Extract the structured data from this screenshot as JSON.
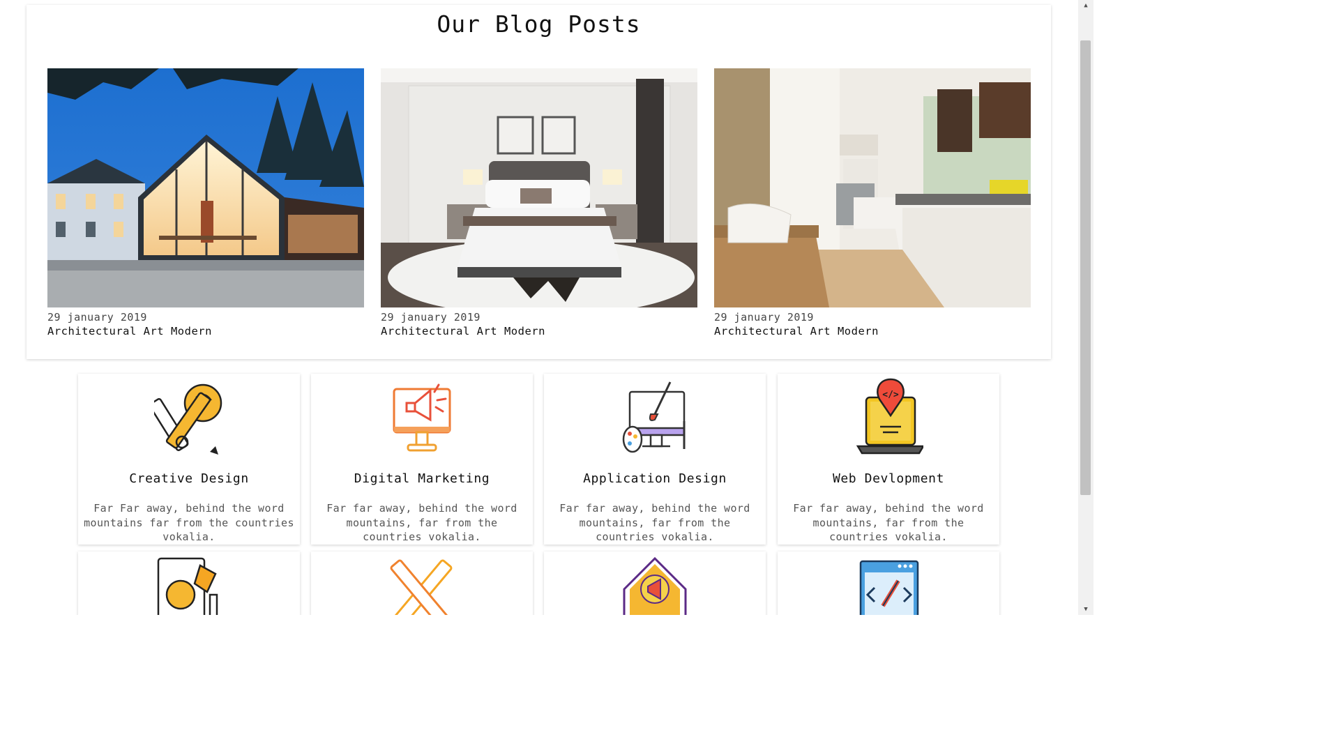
{
  "blog": {
    "title": "Our Blog Posts",
    "posts": [
      {
        "date": "29 january 2019",
        "title": "Architectural Art Modern",
        "image": "glass-house-exterior-night"
      },
      {
        "date": "29 january 2019",
        "title": "Architectural Art Modern",
        "image": "modern-bedroom-interior"
      },
      {
        "date": "29 january 2019",
        "title": "Architectural Art Modern",
        "image": "bright-kitchen-interior"
      }
    ]
  },
  "services": [
    {
      "title": "Creative Design",
      "desc": "Far Far away, behind the word mountains far from the countries vokalia.",
      "icon": "pencil-ruler-bulb-icon"
    },
    {
      "title": "Digital Marketing",
      "desc": "Far far away, behind the word mountains, far from the countries vokalia.",
      "icon": "monitor-megaphone-icon"
    },
    {
      "title": "Application Design",
      "desc": "Far far away, behind the word mountains, far from the countries vokalia.",
      "icon": "monitor-palette-brush-icon"
    },
    {
      "title": "Web Devlopment",
      "desc": "Far far away, behind the word mountains, far from the countries vokalia.",
      "icon": "laptop-code-icon"
    }
  ],
  "services_row2_icons": [
    "document-bulb-tag-icon",
    "pencil-ruler-cross-icon",
    "envelope-megaphone-icon",
    "browser-code-pencil-icon"
  ],
  "colors": {
    "accent_orange": "#f5a623",
    "accent_red": "#e8503a",
    "accent_yellow": "#f3c623",
    "outline": "#222222"
  }
}
